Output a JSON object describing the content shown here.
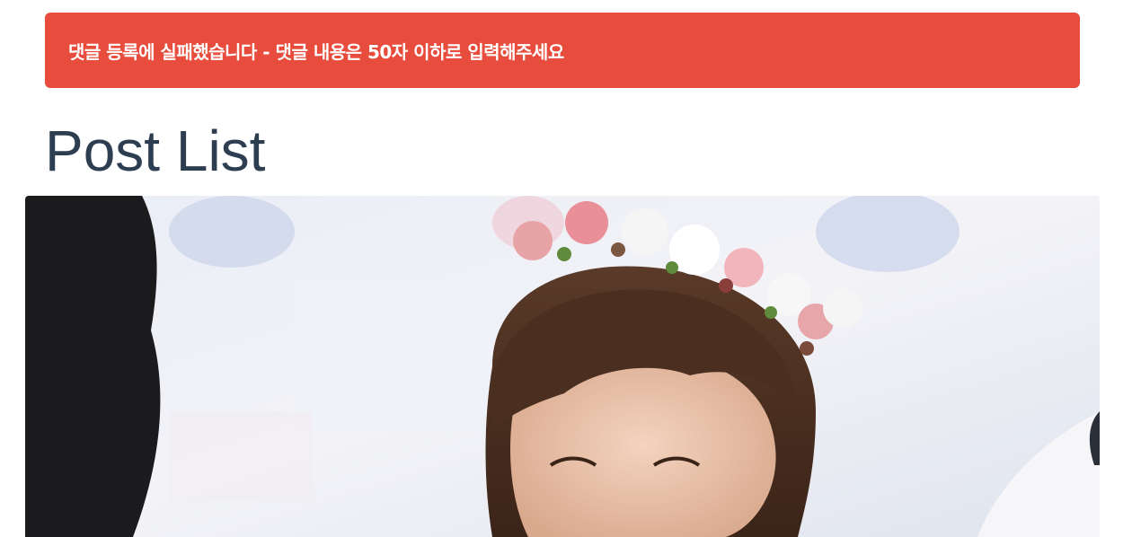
{
  "alert": {
    "message": "댓글 등록에 실패했습니다 - 댓글 내용은 50자 이하로 입력해주세요",
    "color": "#e74c3c"
  },
  "page": {
    "title": "Post List",
    "title_color": "#2c3e50"
  },
  "post": {
    "image": "photo-of-woman-with-flower-crown"
  }
}
